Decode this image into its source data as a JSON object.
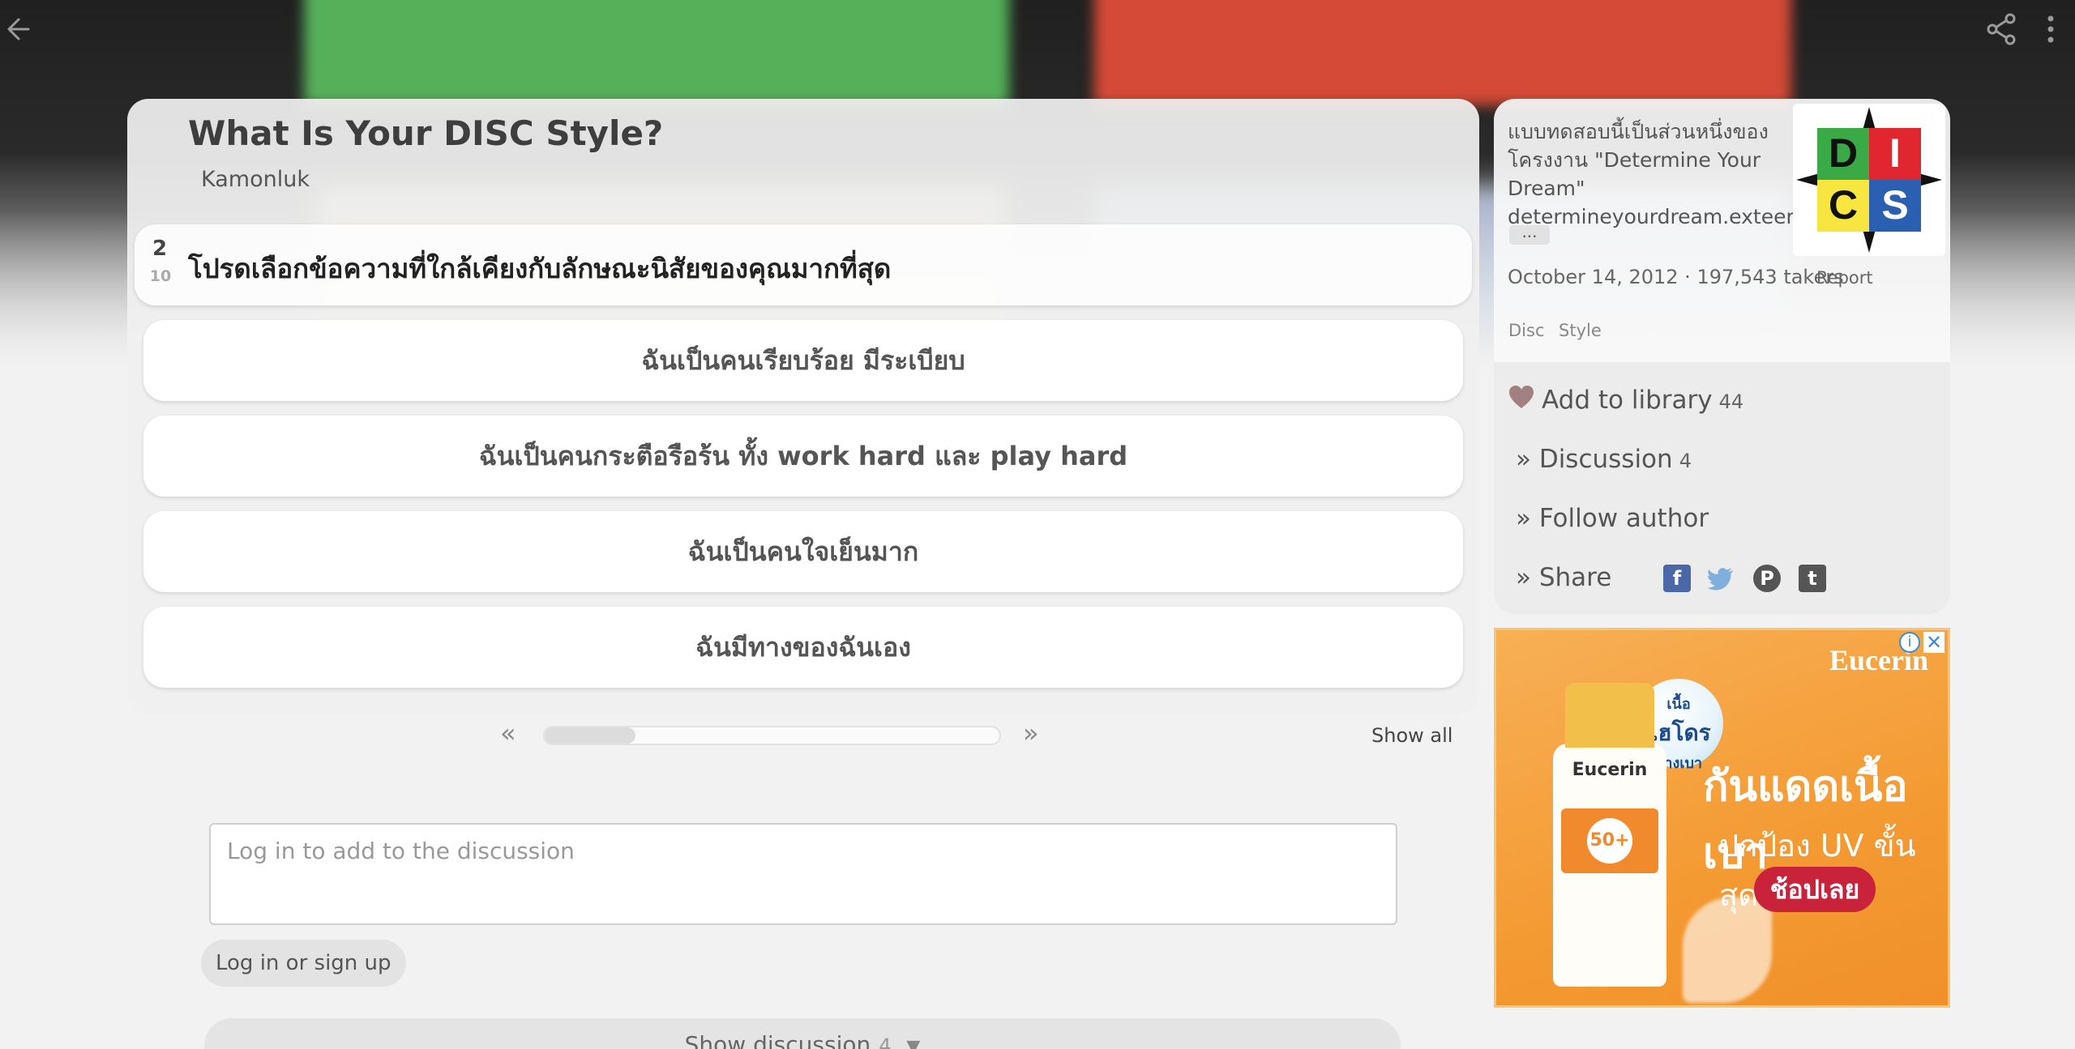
{
  "quiz": {
    "title": "What Is Your DISC Style?",
    "author": "Kamonluk",
    "question_number": "2",
    "question_total": "10",
    "question_text": "โปรดเลือกข้อความที่ใกล้เคียงกับลักษณะนิสัยของคุณมากที่สุด",
    "answers": [
      "ฉันเป็นคนเรียบร้อย มีระเบียบ",
      "ฉันเป็นคนกระตือรือร้น ทั้ง work hard และ play  hard",
      "ฉันเป็นคนใจเย็นมาก",
      "ฉันมีทางของฉันเอง"
    ],
    "progress_fraction": 0.2,
    "prev_label": "«",
    "next_label": "»",
    "show_all_label": "Show all"
  },
  "discussion": {
    "placeholder": "Log in to add to the discussion",
    "login_label": "Log in or sign up",
    "show_label": "Show discussion",
    "show_count": "4",
    "show_arrow": "▼"
  },
  "sidebar": {
    "description": "แบบทดสอบนี้เป็นส่วนหนึ่งของโครงงาน \"Determine Your Dream\" determineyourdream.exteen.c",
    "more_label": "...",
    "logo_letters": [
      "D",
      "I",
      "C",
      "S"
    ],
    "meta": "October 14, 2012 · 197,543 takers",
    "report_label": "Report",
    "tags": [
      "Disc",
      "Style"
    ],
    "add_library_label": "Add to library",
    "add_library_count": "44",
    "discussion_label": "» Discussion",
    "discussion_count": "4",
    "follow_label": "» Follow author",
    "share_label": "» Share"
  },
  "ad": {
    "brand": "Eucerin",
    "headline": "กันแดดเนื้อเบา",
    "subline": "ปกป้อง UV ขั้นสุด",
    "cta": "ช้อปเลย",
    "bubble_line1": "เนื้อ",
    "bubble_line2": "ไฮโดร",
    "bubble_line3": "บางเบา",
    "bottle_brand": "Eucerin",
    "bottle_spf": "50+",
    "info_icon": "i",
    "close_icon": "✕"
  },
  "colors": {
    "logo_green": "#3aaa47",
    "logo_red": "#e0262e",
    "logo_yellow": "#f7e640",
    "logo_blue": "#2b5fb2",
    "facebook": "#4a67a8",
    "twitter": "#7fb0dc",
    "pinterest": "#555555",
    "tumblr": "#555555",
    "heart": "#a08080"
  },
  "icons": {
    "back": "back-arrow-icon",
    "share": "share-icon",
    "more": "more-vertical-icon"
  }
}
